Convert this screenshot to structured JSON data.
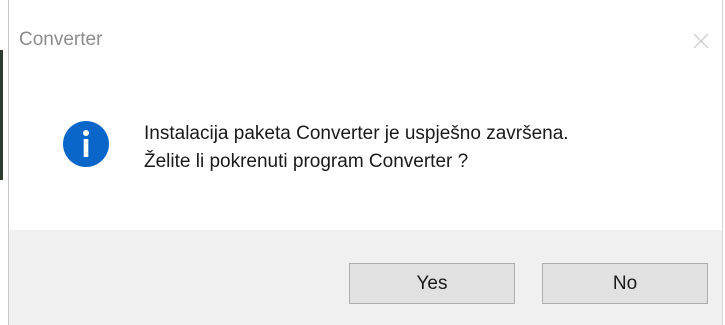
{
  "window": {
    "title": "Converter"
  },
  "message": {
    "line1": "Instalacija paketa Converter je uspješno završena.",
    "line2": "Želite li pokrenuti program Converter ?"
  },
  "icons": {
    "close": "close-icon",
    "info": "info-icon"
  },
  "buttons": {
    "yes_label": "Yes",
    "no_label": "No"
  },
  "colors": {
    "info_accent": "#0a67c9",
    "footer_bg": "#f0f0f0",
    "button_bg": "#e1e1e1",
    "button_border": "#adadad",
    "title_text": "#8c8c8c"
  }
}
